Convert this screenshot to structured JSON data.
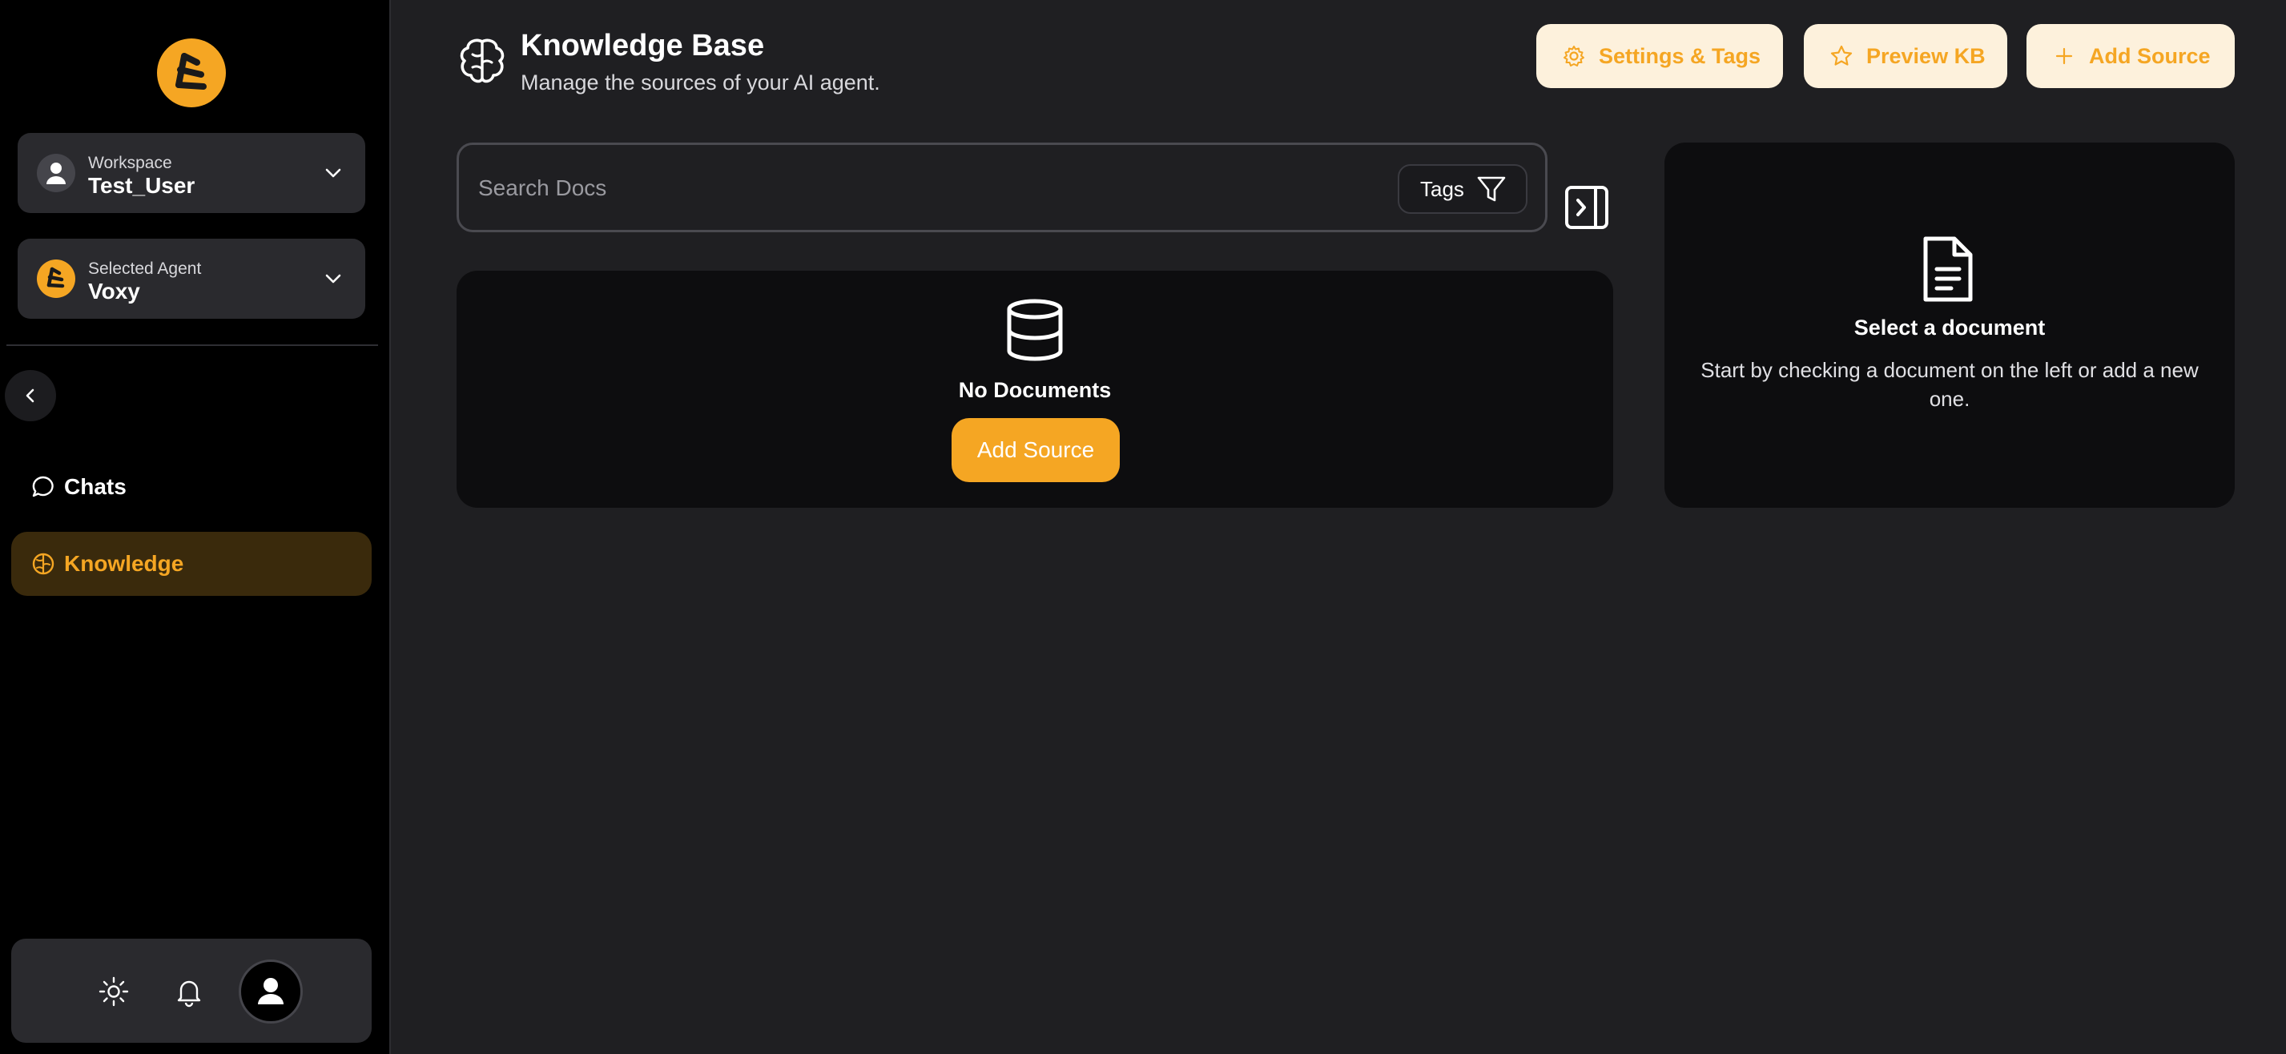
{
  "sidebar": {
    "logo_icon": "voxy-logo-icon",
    "workspace": {
      "caption": "Workspace",
      "value": "Test_User"
    },
    "agent": {
      "caption": "Selected Agent",
      "value": "Voxy"
    },
    "nav": [
      {
        "label": "Chats",
        "icon": "chat-bubble-icon",
        "active": false
      },
      {
        "label": "Knowledge",
        "icon": "brain-icon",
        "active": true
      }
    ],
    "bottom": {
      "theme_icon": "sun-icon",
      "notifications_icon": "bell-icon",
      "profile_icon": "user-avatar-icon"
    }
  },
  "header": {
    "title": "Knowledge Base",
    "subtitle": "Manage the sources of your AI agent.",
    "buttons": {
      "settings": "Settings & Tags",
      "preview": "Preview KB",
      "add": "Add Source"
    }
  },
  "search": {
    "placeholder": "Search Docs",
    "value": "",
    "tags_label": "Tags"
  },
  "documents": {
    "empty_title": "No Documents",
    "add_label": "Add Source"
  },
  "document_panel": {
    "title": "Select a document",
    "description": "Start by checking a document on the left or add a new one."
  },
  "colors": {
    "accent": "#f5a623",
    "accent_soft": "#fdf1dc",
    "sidebar_bg": "#000000",
    "main_bg": "#1f1f22",
    "card_bg": "#0d0d0f",
    "active_nav_bg": "#3a2a0c"
  }
}
